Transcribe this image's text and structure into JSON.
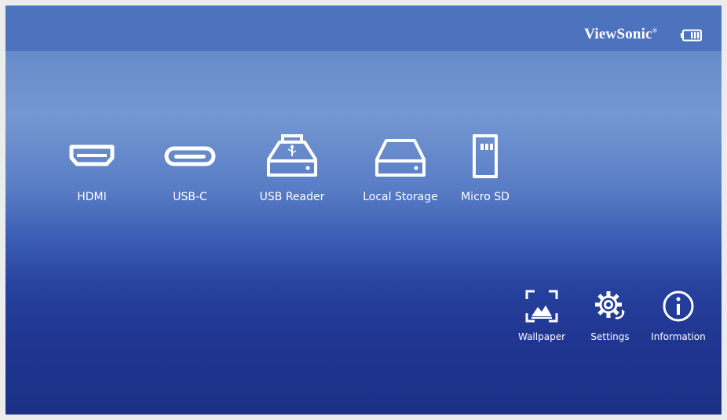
{
  "header": {
    "brand": "ViewSonic",
    "brand_mark": "®",
    "battery_icon": "battery-icon"
  },
  "sources": [
    {
      "label": "HDMI",
      "icon": "hdmi-icon"
    },
    {
      "label": "USB-C",
      "icon": "usb-c-icon"
    },
    {
      "label": "USB Reader",
      "icon": "usb-reader-icon"
    },
    {
      "label": "Local Storage",
      "icon": "local-storage-icon"
    },
    {
      "label": "Micro SD",
      "icon": "micro-sd-icon"
    }
  ],
  "tools": [
    {
      "label": "Wallpaper",
      "icon": "wallpaper-icon"
    },
    {
      "label": "Settings",
      "icon": "settings-gear-icon"
    },
    {
      "label": "Information",
      "icon": "info-icon"
    }
  ],
  "colors": {
    "top_bar": "#4e73be",
    "gradient_top": "#6c90cc",
    "gradient_bottom": "#1c3087",
    "text": "#ffffff"
  }
}
